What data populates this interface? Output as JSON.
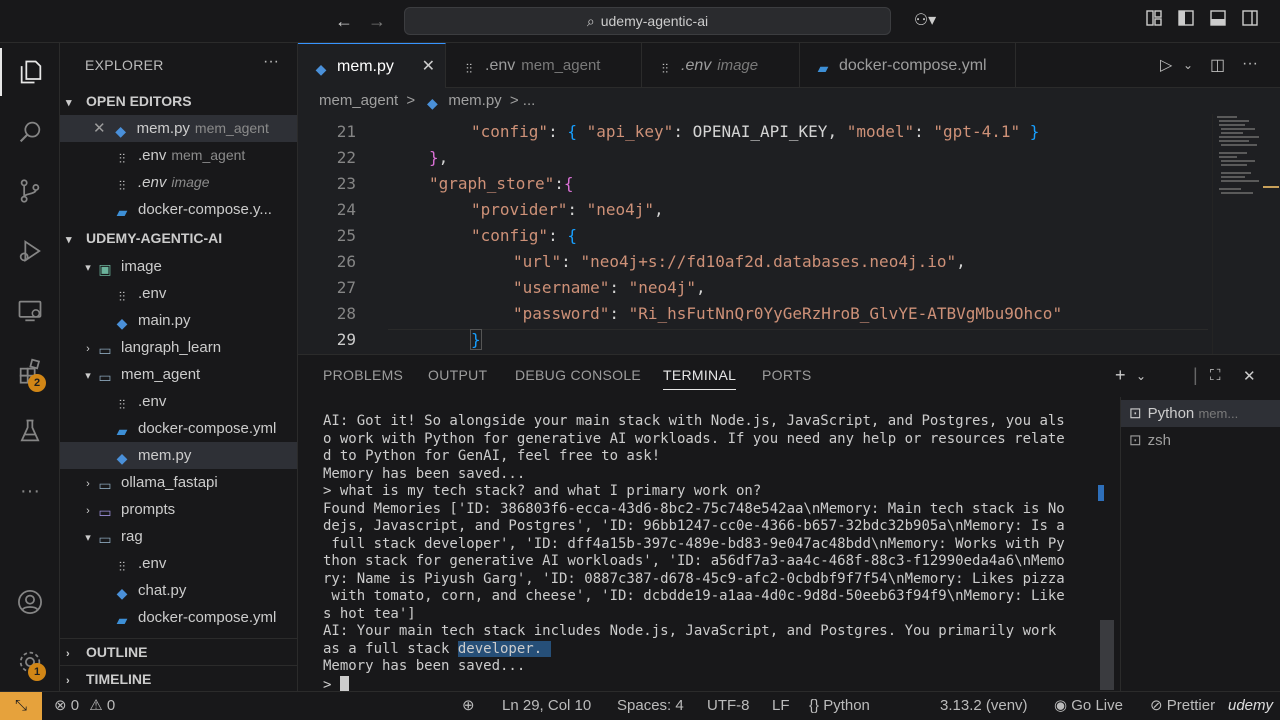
{
  "titlebar": {
    "search_text": "udemy-agentic-ai"
  },
  "activity": {
    "extensions_badge": "2",
    "settings_badge": "1"
  },
  "sidebar": {
    "title": "EXPLORER",
    "open_editors_label": "OPEN EDITORS",
    "open_editors": [
      {
        "name": "mem.py",
        "folder": "mem_agent"
      },
      {
        "name": ".env",
        "folder": "mem_agent"
      },
      {
        "name": ".env",
        "folder": "image"
      },
      {
        "name": "docker-compose.y...",
        "folder": ""
      }
    ],
    "workspace_label": "UDEMY-AGENTIC-AI",
    "tree": [
      {
        "name": "image"
      },
      {
        "name": ".env"
      },
      {
        "name": "main.py"
      },
      {
        "name": "langraph_learn"
      },
      {
        "name": "mem_agent"
      },
      {
        "name": ".env"
      },
      {
        "name": "docker-compose.yml"
      },
      {
        "name": "mem.py"
      },
      {
        "name": "ollama_fastapi"
      },
      {
        "name": "prompts"
      },
      {
        "name": "rag"
      },
      {
        "name": ".env"
      },
      {
        "name": "chat.py"
      },
      {
        "name": "docker-compose.yml"
      }
    ],
    "outline_label": "OUTLINE",
    "timeline_label": "TIMELINE"
  },
  "tabs": [
    {
      "name": "mem.py",
      "sub": ""
    },
    {
      "name": ".env",
      "sub": "mem_agent"
    },
    {
      "name": ".env",
      "sub": "image"
    },
    {
      "name": "docker-compose.yml",
      "sub": ""
    }
  ],
  "breadcrumb": {
    "folder": "mem_agent",
    "sep": ">",
    "file": "mem.py",
    "tail": "> ..."
  },
  "editor": {
    "line_numbers": [
      "21",
      "22",
      "23",
      "24",
      "25",
      "26",
      "27",
      "28",
      "29"
    ],
    "lines": {
      "l21_key": "\"config\"",
      "l21_k1": "\"api_key\"",
      "l21_id": "OPENAI_API_KEY",
      "l21_k2": "\"model\"",
      "l21_v2": "\"gpt-4.1\"",
      "l23_key": "\"graph_store\"",
      "l24_key": "\"provider\"",
      "l24_val": "\"neo4j\"",
      "l25_key": "\"config\"",
      "l26_key": "\"url\"",
      "l26_val": "\"neo4j+s://fd10af2d.databases.neo4j.io\"",
      "l27_key": "\"username\"",
      "l27_val": "\"neo4j\"",
      "l28_key": "\"password\"",
      "l28_val": "\"Ri_hsFutNnQr0YyGeRzHroB_GlvYE-ATBVgMbu9Ohco\""
    }
  },
  "panel": {
    "tabs": [
      "PROBLEMS",
      "OUTPUT",
      "DEBUG CONSOLE",
      "TERMINAL",
      "PORTS"
    ],
    "active_tab": "TERMINAL",
    "terminal_lines": [
      "AI: Got it! So alongside your main stack with Node.js, JavaScript, and Postgres, you als",
      "o work with Python for generative AI workloads. If you need any help or resources relate",
      "d to Python for GenAI, feel free to ask!",
      "Memory has been saved...",
      "> what is my tech stack? and what I primary work on?",
      "Found Memories ['ID: 386803f6-ecca-43d6-8bc2-75c748e542aa\\nMemory: Main tech stack is No",
      "dejs, Javascript, and Postgres', 'ID: 96bb1247-cc0e-4366-b657-32bdc32b905a\\nMemory: Is a",
      " full stack developer', 'ID: dff4a15b-397c-489e-bd83-9e047ac48bdd\\nMemory: Works with Py",
      "thon stack for generative AI workloads', 'ID: a56df7a3-aa4c-468f-88c3-f12990eda4a6\\nMemo",
      "ry: Name is Piyush Garg', 'ID: 0887c387-d678-45c9-afc2-0cbdbf9f7f54\\nMemory: Likes pizza",
      " with tomato, corn, and cheese', 'ID: dcbdde19-a1aa-4d0c-9d8d-50eeb63f94f9\\nMemory: Like",
      "s hot tea']",
      "AI: Your main tech stack includes Node.js, JavaScript, and Postgres. You primarily work"
    ],
    "line_as_full": "as a full stack ",
    "line_as_full_hl": "developer. ",
    "line_saved": "Memory has been saved...",
    "prompt": "> ",
    "terminals": [
      {
        "name": "Python",
        "sub": "mem..."
      },
      {
        "name": "zsh",
        "sub": ""
      }
    ]
  },
  "statusbar": {
    "errors": "0",
    "warnings": "0",
    "position": "Ln 29, Col 10",
    "spaces": "Spaces: 4",
    "encoding": "UTF-8",
    "eol": "LF",
    "language": "Python",
    "interpreter": "3.13.2 (venv)",
    "golive": "Go Live",
    "prettier": "Prettier",
    "watermark": "udemy"
  }
}
